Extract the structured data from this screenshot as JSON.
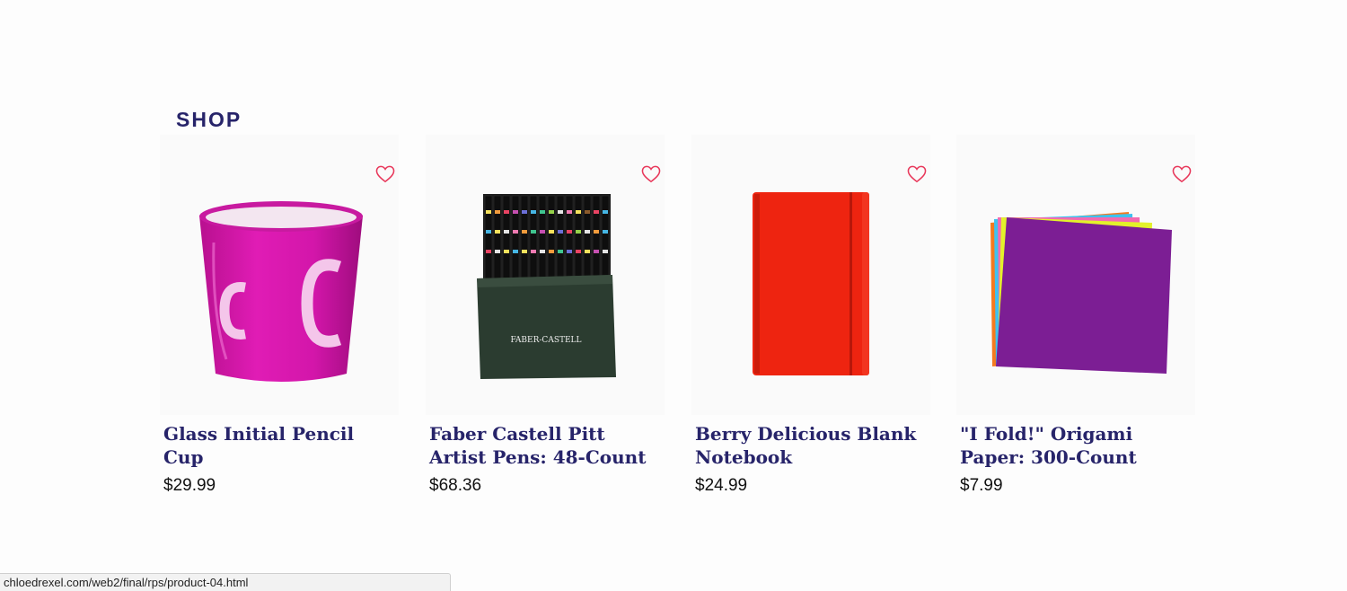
{
  "section": {
    "title": "SHOP"
  },
  "products": [
    {
      "name": "Glass Initial Pencil Cup",
      "price": "$29.99",
      "image": "pink-pencil-cup-image"
    },
    {
      "name": "Faber Castell Pitt Artist Pens: 48-Count",
      "price": "$68.36",
      "image": "faber-castell-pen-box-image",
      "brand_text": "FABER-CASTELL"
    },
    {
      "name": "Berry Delicious Blank Notebook",
      "price": "$24.99",
      "image": "red-notebook-image"
    },
    {
      "name": "\"I Fold!\" Origami Paper: 300-Count",
      "price": "$7.99",
      "image": "origami-paper-stack-image"
    }
  ],
  "icons": {
    "favorite": "heart-outline-icon"
  },
  "colors": {
    "heading": "#27246a",
    "heart": "#e8375a"
  },
  "status_bar": {
    "url": "chloedrexel.com/web2/final/rps/product-04.html"
  }
}
